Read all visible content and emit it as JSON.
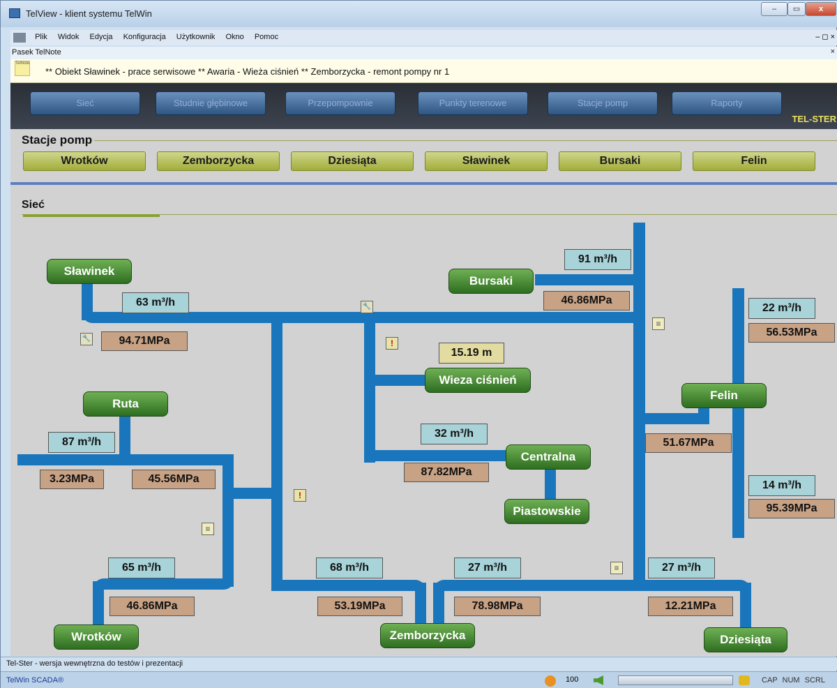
{
  "window": {
    "title": "TelView - klient systemu TelWin",
    "controls": {
      "minimize": "–",
      "maximize": "▭",
      "close": "x"
    }
  },
  "menu": {
    "items": [
      "Plik",
      "Widok",
      "Edycja",
      "Konfiguracja",
      "Użytkownik",
      "Okno",
      "Pomoc"
    ],
    "right_controls": "– ◻ ×"
  },
  "telnote": {
    "bar_title": "Pasek TelNote",
    "close": "×",
    "icon_text": "TelNote",
    "ticker": "** Obiekt Sławinek - prace serwisowe ** Awaria - Wieża ciśnień ** Zemborzycka - remont pompy nr 1"
  },
  "nav": {
    "tabs": [
      "Sieć",
      "Studnie głębinowe",
      "Przepompownie",
      "Punkty terenowe",
      "Stacje pomp",
      "Raporty"
    ],
    "brand": "TEL-STER"
  },
  "stations_section": {
    "title": "Stacje pomp",
    "buttons": [
      "Wrotków",
      "Zemborzycka",
      "Dziesiąta",
      "Sławinek",
      "Bursaki",
      "Felin"
    ]
  },
  "network_section": {
    "title": "Sieć"
  },
  "network": {
    "nodes": {
      "slawinek": "Sławinek",
      "bursaki": "Bursaki",
      "wieza": "Wieza ciśnień",
      "felin": "Felin",
      "ruta": "Ruta",
      "centralna": "Centralna",
      "piastowskie": "Piastowskie",
      "wrotkow": "Wrotków",
      "zemborzycka": "Zemborzycka",
      "dziesiata": "Dziesiąta"
    },
    "flows": {
      "bursaki": "91 m³/h",
      "slawinek": "63 m³/h",
      "felin_top": "22 m³/h",
      "ruta": "87 m³/h",
      "centralna": "32 m³/h",
      "felin_bottom": "14 m³/h",
      "wrotkow": "65 m³/h",
      "zemb_left": "68 m³/h",
      "zemb_right": "27 m³/h",
      "dziesiata": "27 m³/h"
    },
    "pressures": {
      "bursaki": "46.86MPa",
      "felin_top": "56.53MPa",
      "slawinek": "94.71MPa",
      "felin_mid": "51.67MPa",
      "ruta_left": "3.23MPa",
      "ruta_right": "45.56MPa",
      "centralna": "87.82MPa",
      "felin_bottom": "95.39MPa",
      "wrotkow": "46.86MPa",
      "zemb_left": "53.19MPa",
      "zemb_right": "78.98MPa",
      "dziesiata": "12.21MPa"
    },
    "level": "15.19 m",
    "markers": {
      "alert": "!",
      "wrench": "🔧",
      "doc": "≡"
    }
  },
  "status": {
    "info_line": "Tel-Ster - wersja wewnętrzna do testów i prezentacji",
    "product": "TelWin SCADA®",
    "volume": "100",
    "locks": [
      "CAP",
      "NUM",
      "SCRL"
    ]
  }
}
